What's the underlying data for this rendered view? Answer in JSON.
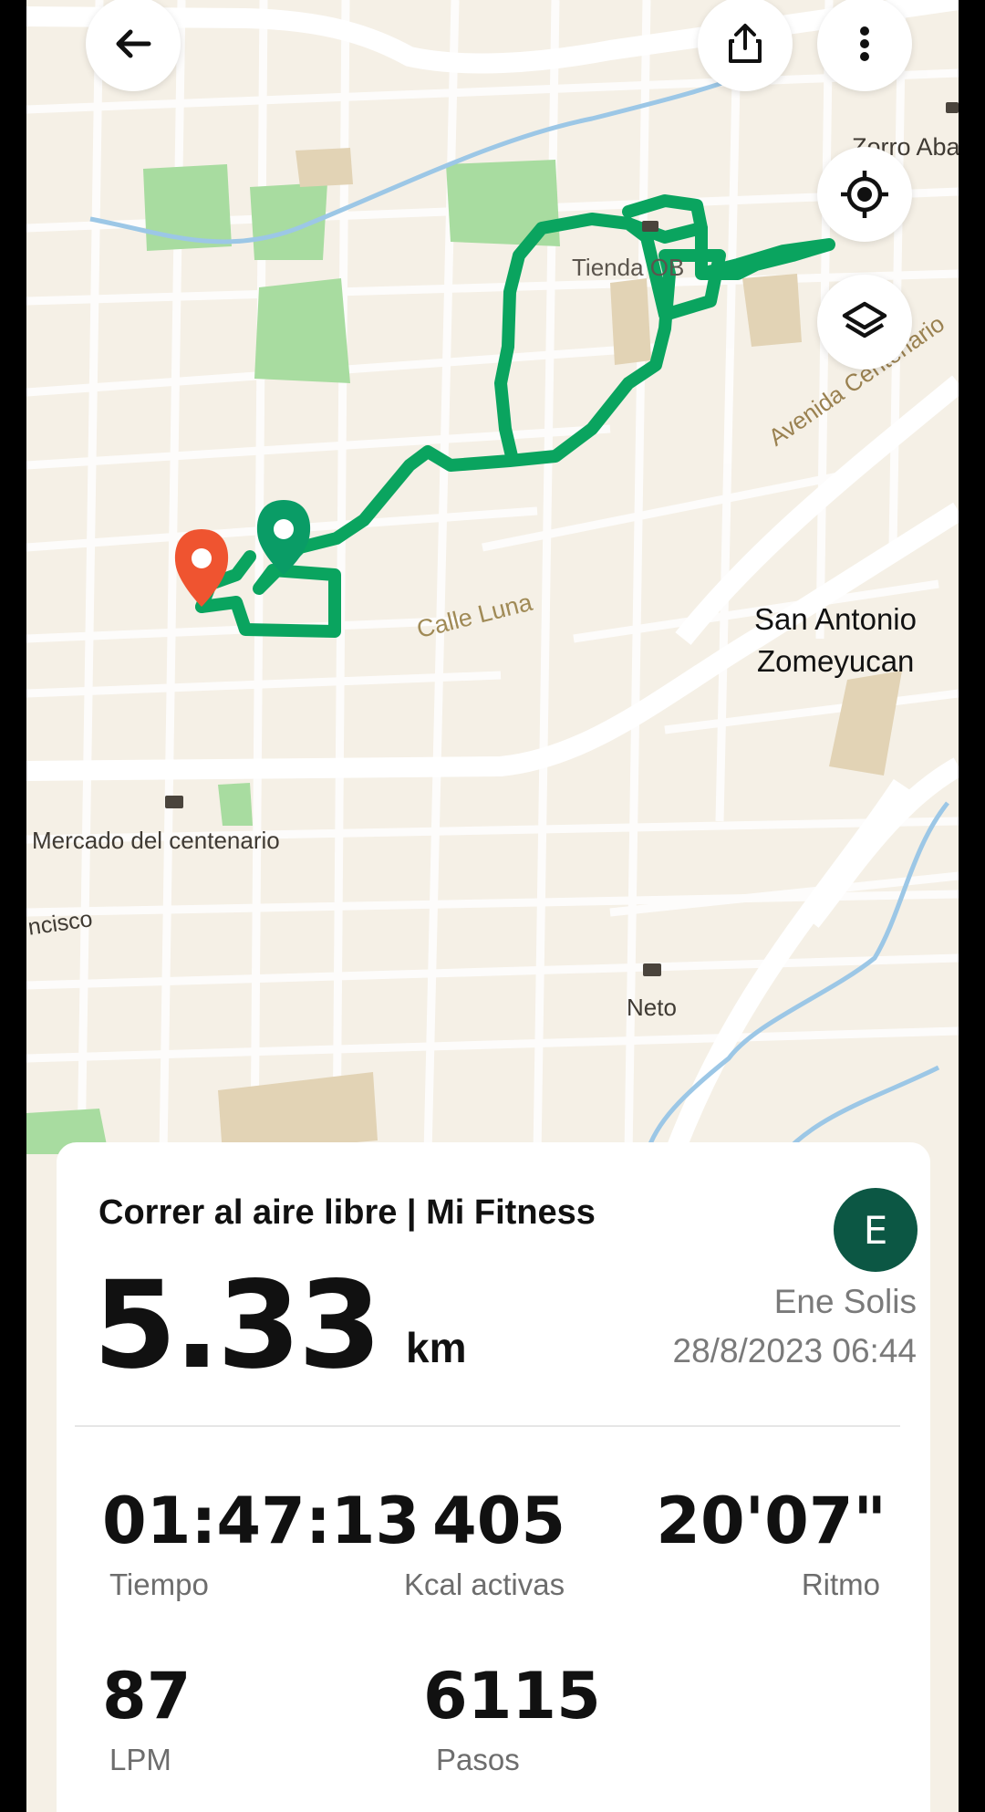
{
  "colors": {
    "route": "#0aa45f",
    "start_marker": "#0a9c66",
    "end_marker": "#ef5430",
    "avatar_bg": "#0c5744",
    "map_bg": "#f5f0e6"
  },
  "map": {
    "labels": {
      "zorro": "Zorro Aba",
      "tienda": "Tienda OB",
      "avenida": "Avenida Centenario",
      "calle_luna": "Calle Luna",
      "san_antonio_1": "San Antonio",
      "san_antonio_2": "Zomeyucan",
      "mercado": "Mercado del centenario",
      "francisco": "ncisco",
      "neto": "Neto"
    }
  },
  "toolbar": {
    "back_icon": "arrow-left",
    "share_icon": "share",
    "more_icon": "more-vertical",
    "locate_icon": "gps-target",
    "layers_icon": "layers"
  },
  "summary": {
    "title": "Correr al aire libre | Mi Fitness",
    "distance_value": "5.33",
    "distance_unit": "km",
    "avatar_initial": "E",
    "user_name": "Ene Solis",
    "datetime": "28/8/2023 06:44"
  },
  "stats": {
    "time": {
      "value": "01:47:13",
      "label": "Tiempo"
    },
    "kcal": {
      "value": "405",
      "label": "Kcal activas"
    },
    "pace": {
      "value": "20'07\"",
      "label": "Ritmo"
    },
    "bpm": {
      "value": "87",
      "label": "LPM"
    },
    "steps": {
      "value": "6115",
      "label": "Pasos"
    }
  }
}
